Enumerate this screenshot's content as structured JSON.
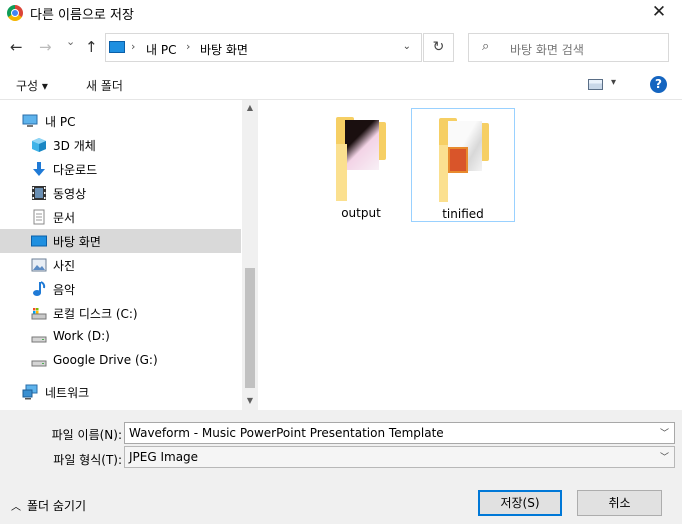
{
  "window": {
    "title": "다른 이름으로 저장",
    "close_label": "✕"
  },
  "nav": {
    "back": "←",
    "forward": "→",
    "recent": "⌄",
    "up": "↑",
    "address": {
      "segments": [
        "내 PC",
        "바탕 화면"
      ],
      "sep": "›",
      "dropdown": "⌄"
    },
    "refresh": "↻",
    "search": {
      "icon": "⌕",
      "placeholder": "바탕 화면 검색"
    }
  },
  "toolbar": {
    "organize": "구성 ▾",
    "new_folder": "새 폴더",
    "view_dropdown": "▾",
    "help": "?"
  },
  "sidebar": {
    "items": [
      {
        "label": "내 PC",
        "icon": "pc-icon"
      },
      {
        "label": "3D 개체",
        "icon": "3d-objects-icon"
      },
      {
        "label": "다운로드",
        "icon": "download-icon"
      },
      {
        "label": "동영상",
        "icon": "video-icon"
      },
      {
        "label": "문서",
        "icon": "document-icon"
      },
      {
        "label": "바탕 화면",
        "icon": "desktop-icon",
        "selected": true
      },
      {
        "label": "사진",
        "icon": "picture-icon"
      },
      {
        "label": "음악",
        "icon": "music-icon"
      },
      {
        "label": "로컬 디스크 (C:)",
        "icon": "local-disk-icon"
      },
      {
        "label": "Work (D:)",
        "icon": "drive-icon"
      },
      {
        "label": "Google Drive (G:)",
        "icon": "drive-icon"
      },
      {
        "label": "네트워크",
        "icon": "network-icon"
      }
    ],
    "scroll_up": "▲",
    "scroll_down": "▼"
  },
  "files": [
    {
      "name": "output",
      "selected": false
    },
    {
      "name": "tinified",
      "selected": true
    }
  ],
  "form": {
    "filename_label": "파일 이름(N):",
    "filename_value": "Waveform - Music PowerPoint Presentation Template",
    "filetype_label": "파일 형식(T):",
    "filetype_value": "JPEG Image",
    "combo_arrow": "﹀"
  },
  "footer": {
    "hide_folders_caret": "︿",
    "hide_folders": "폴더 숨기기",
    "save": "저장(S)",
    "cancel": "취소"
  }
}
